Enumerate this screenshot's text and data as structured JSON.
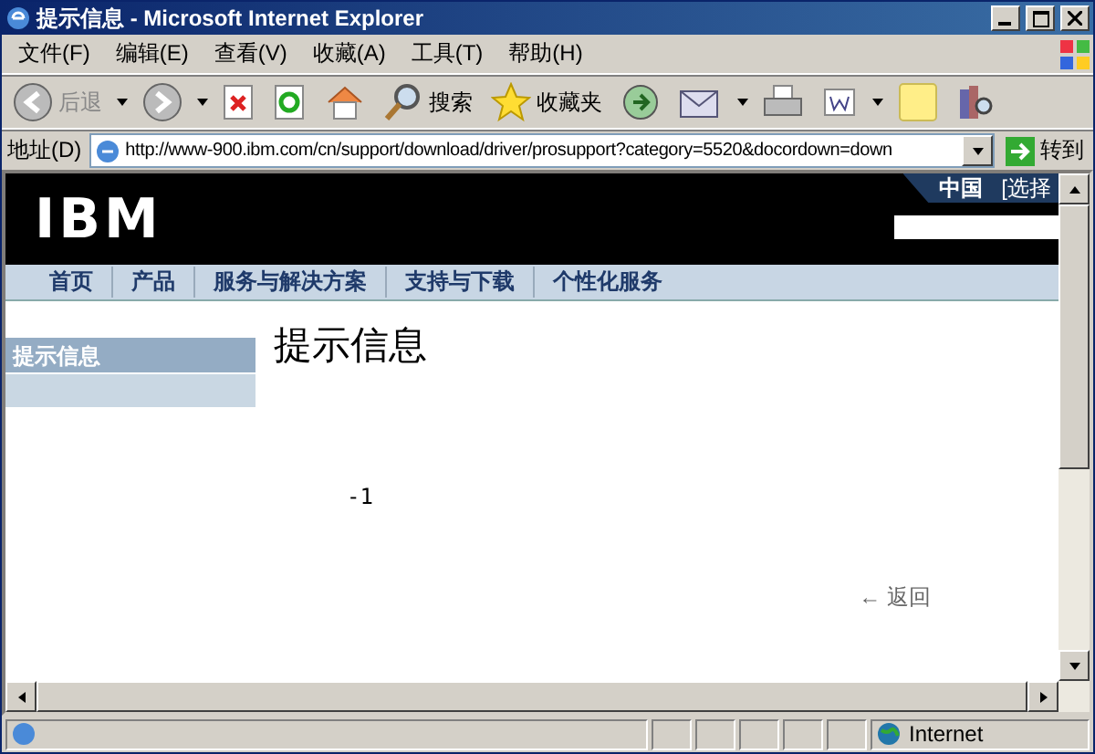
{
  "window": {
    "title": "提示信息 - Microsoft Internet Explorer"
  },
  "menu": [
    "文件(F)",
    "编辑(E)",
    "查看(V)",
    "收藏(A)",
    "工具(T)",
    "帮助(H)"
  ],
  "toolbar": {
    "back": {
      "label": "后退",
      "disabled": true
    },
    "search": "搜索",
    "favorites": "收藏夹"
  },
  "address": {
    "label": "地址(D)",
    "url": "http://www-900.ibm.com/cn/support/download/driver/prosupport?category=5520&docordown=down",
    "go": "转到"
  },
  "page": {
    "logo": "IBM",
    "region": "中国",
    "region_select": "[选择",
    "nav": [
      "首页",
      "产品",
      "服务与解决方案",
      "支持与下载",
      "个性化服务"
    ],
    "sidebar": {
      "title": "提示信息"
    },
    "heading": "提示信息",
    "message": "-1",
    "back_link": "← 返回"
  },
  "status": {
    "zone": "Internet"
  }
}
